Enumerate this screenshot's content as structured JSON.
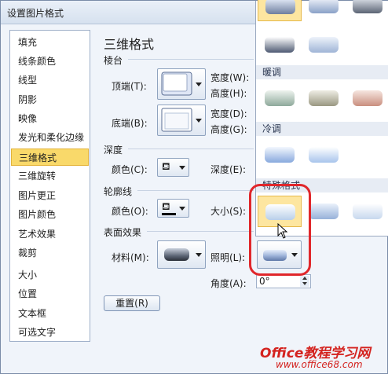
{
  "window": {
    "title": "设置图片格式"
  },
  "sidebar": {
    "items": [
      {
        "label": "填充"
      },
      {
        "label": "线条颜色"
      },
      {
        "label": "线型"
      },
      {
        "label": "阴影"
      },
      {
        "label": "映像"
      },
      {
        "label": "发光和柔化边缘"
      },
      {
        "label": "三维格式",
        "selected": true
      },
      {
        "label": "三维旋转"
      },
      {
        "label": "图片更正"
      },
      {
        "label": "图片颜色"
      },
      {
        "label": "艺术效果"
      },
      {
        "label": "裁剪"
      },
      {
        "label": "大小"
      },
      {
        "label": "位置"
      },
      {
        "label": "文本框"
      },
      {
        "label": "可选文字"
      }
    ]
  },
  "panel": {
    "heading": "三维格式",
    "bevel": {
      "section": "棱台",
      "top_label": "顶端(T):",
      "bottom_label": "底端(B):",
      "width_label_1": "宽度(W):",
      "height_label_1": "高度(H):",
      "width_label_2": "宽度(D):",
      "height_label_2": "高度(G):"
    },
    "depth": {
      "section": "深度",
      "color_label": "颜色(C):",
      "depth_label": "深度(E):"
    },
    "contour": {
      "section": "轮廓线",
      "color_label": "颜色(O):",
      "size_label": "大小(S):"
    },
    "surface": {
      "section": "表面效果",
      "material_label": "材料(M):",
      "lighting_label": "照明(L):",
      "angle_label": "角度(A):",
      "angle_value": "0°"
    },
    "reset_label": "重置(R)"
  },
  "gallery": {
    "groups": [
      {
        "name": "暖调"
      },
      {
        "name": "冷调"
      },
      {
        "name": "特殊格式"
      }
    ],
    "colors": {
      "neutral": "#9fb4d6",
      "warm_1": "#8ea99b",
      "warm_2": "#9a9882",
      "warm_3": "#c98f7f",
      "cool_1": "#88a9dd",
      "cool_2": "#a8c4ec",
      "special_1": "#b9cfe9",
      "special_2": "#97b1d9",
      "special_3": "#c7d8ee",
      "selected_bg": "#fde6a0",
      "ring": "#e0272b"
    }
  },
  "watermark": {
    "line1": "Office教程学习网",
    "line2": "www.office68.com"
  }
}
